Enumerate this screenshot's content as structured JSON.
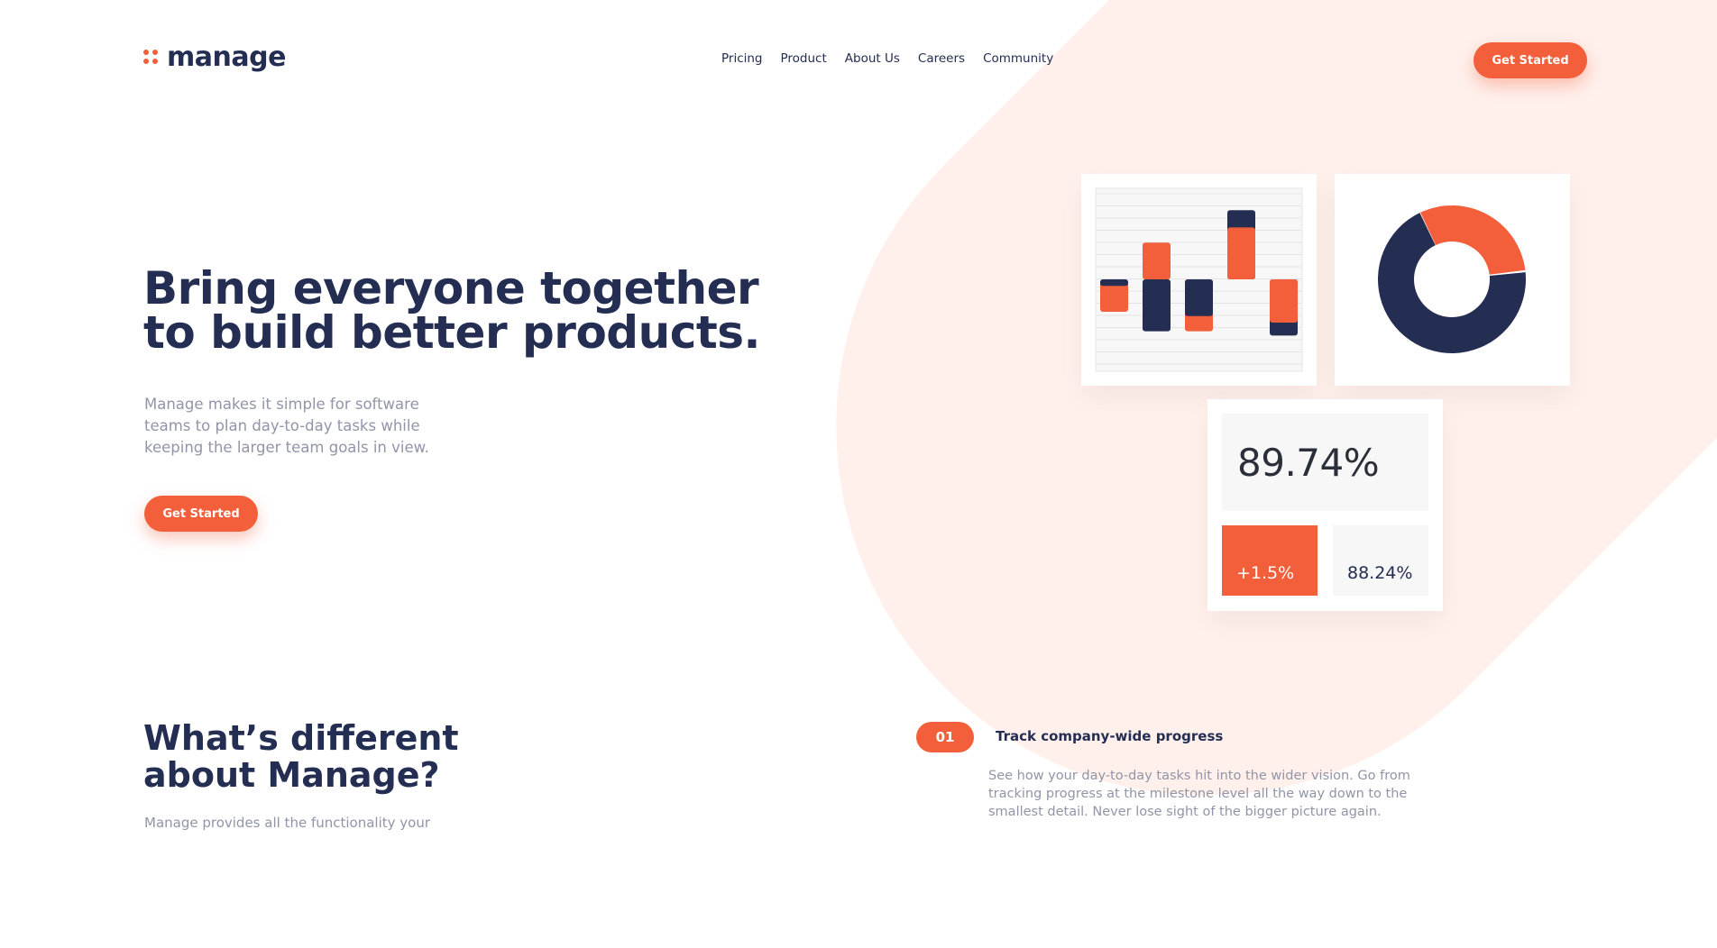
{
  "brand": {
    "name": "manage",
    "accent": "#f25f3a",
    "navy": "#242d52"
  },
  "nav": {
    "items": [
      {
        "label": "Pricing",
        "id": "pricing"
      },
      {
        "label": "Product",
        "id": "product"
      },
      {
        "label": "About Us",
        "id": "about-us"
      },
      {
        "label": "Careers",
        "id": "careers"
      },
      {
        "label": "Community",
        "id": "community"
      }
    ]
  },
  "header": {
    "cta_label": "Get Started"
  },
  "hero": {
    "title": "Bring everyone together to build better products.",
    "subtitle": "Manage makes it simple for software teams to plan day-to-day tasks while keeping the larger team goals in view.",
    "cta_label": "Get Started"
  },
  "illustration": {
    "bar_chart": {
      "description_values": [
        {
          "navy": -0.15,
          "orange": -0.75
        },
        {
          "navy": -1.2,
          "orange": 0.85
        },
        {
          "navy": -0.85,
          "orange": -1.2
        },
        {
          "navy": 1.6,
          "orange": 1.2
        },
        {
          "navy": -1.3,
          "orange": -1.0
        }
      ]
    },
    "donut": {
      "orange_share": 0.3,
      "navy_share": 0.7
    },
    "stats": {
      "main": "89.74%",
      "change": "+1.5%",
      "secondary": "88.24%"
    }
  },
  "different": {
    "title": "What’s different about Manage?",
    "text": "Manage provides all the functionality your"
  },
  "features": [
    {
      "number": "01",
      "title": "Track company-wide progress",
      "text": "See how your day-to-day tasks hit into the wider vision. Go from tracking progress at the milestone level all the way down to the smallest detail. Never lose sight of the bigger picture again."
    }
  ]
}
